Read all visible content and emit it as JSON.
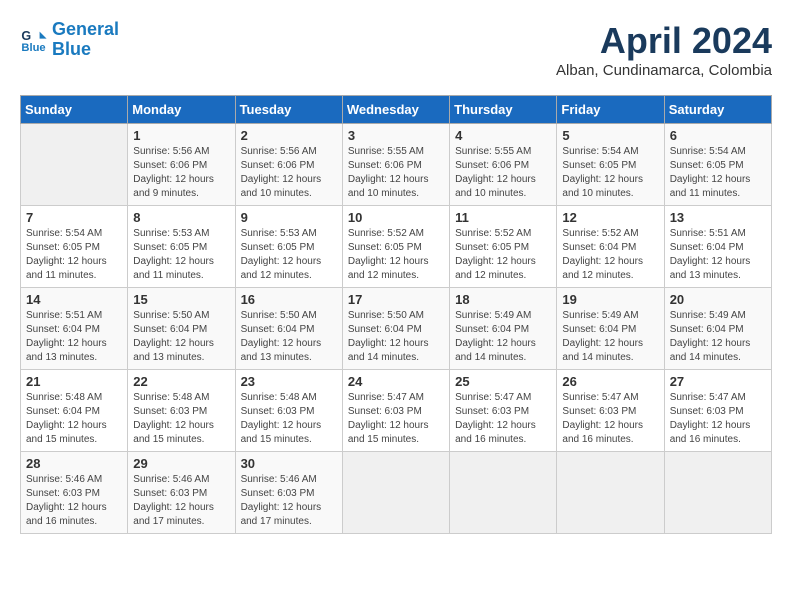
{
  "header": {
    "logo_line1": "General",
    "logo_line2": "Blue",
    "month_title": "April 2024",
    "location": "Alban, Cundinamarca, Colombia"
  },
  "days_of_week": [
    "Sunday",
    "Monday",
    "Tuesday",
    "Wednesday",
    "Thursday",
    "Friday",
    "Saturday"
  ],
  "weeks": [
    [
      {
        "day": "",
        "info": ""
      },
      {
        "day": "1",
        "info": "Sunrise: 5:56 AM\nSunset: 6:06 PM\nDaylight: 12 hours\nand 9 minutes."
      },
      {
        "day": "2",
        "info": "Sunrise: 5:56 AM\nSunset: 6:06 PM\nDaylight: 12 hours\nand 10 minutes."
      },
      {
        "day": "3",
        "info": "Sunrise: 5:55 AM\nSunset: 6:06 PM\nDaylight: 12 hours\nand 10 minutes."
      },
      {
        "day": "4",
        "info": "Sunrise: 5:55 AM\nSunset: 6:06 PM\nDaylight: 12 hours\nand 10 minutes."
      },
      {
        "day": "5",
        "info": "Sunrise: 5:54 AM\nSunset: 6:05 PM\nDaylight: 12 hours\nand 10 minutes."
      },
      {
        "day": "6",
        "info": "Sunrise: 5:54 AM\nSunset: 6:05 PM\nDaylight: 12 hours\nand 11 minutes."
      }
    ],
    [
      {
        "day": "7",
        "info": "Sunrise: 5:54 AM\nSunset: 6:05 PM\nDaylight: 12 hours\nand 11 minutes."
      },
      {
        "day": "8",
        "info": "Sunrise: 5:53 AM\nSunset: 6:05 PM\nDaylight: 12 hours\nand 11 minutes."
      },
      {
        "day": "9",
        "info": "Sunrise: 5:53 AM\nSunset: 6:05 PM\nDaylight: 12 hours\nand 12 minutes."
      },
      {
        "day": "10",
        "info": "Sunrise: 5:52 AM\nSunset: 6:05 PM\nDaylight: 12 hours\nand 12 minutes."
      },
      {
        "day": "11",
        "info": "Sunrise: 5:52 AM\nSunset: 6:05 PM\nDaylight: 12 hours\nand 12 minutes."
      },
      {
        "day": "12",
        "info": "Sunrise: 5:52 AM\nSunset: 6:04 PM\nDaylight: 12 hours\nand 12 minutes."
      },
      {
        "day": "13",
        "info": "Sunrise: 5:51 AM\nSunset: 6:04 PM\nDaylight: 12 hours\nand 13 minutes."
      }
    ],
    [
      {
        "day": "14",
        "info": "Sunrise: 5:51 AM\nSunset: 6:04 PM\nDaylight: 12 hours\nand 13 minutes."
      },
      {
        "day": "15",
        "info": "Sunrise: 5:50 AM\nSunset: 6:04 PM\nDaylight: 12 hours\nand 13 minutes."
      },
      {
        "day": "16",
        "info": "Sunrise: 5:50 AM\nSunset: 6:04 PM\nDaylight: 12 hours\nand 13 minutes."
      },
      {
        "day": "17",
        "info": "Sunrise: 5:50 AM\nSunset: 6:04 PM\nDaylight: 12 hours\nand 14 minutes."
      },
      {
        "day": "18",
        "info": "Sunrise: 5:49 AM\nSunset: 6:04 PM\nDaylight: 12 hours\nand 14 minutes."
      },
      {
        "day": "19",
        "info": "Sunrise: 5:49 AM\nSunset: 6:04 PM\nDaylight: 12 hours\nand 14 minutes."
      },
      {
        "day": "20",
        "info": "Sunrise: 5:49 AM\nSunset: 6:04 PM\nDaylight: 12 hours\nand 14 minutes."
      }
    ],
    [
      {
        "day": "21",
        "info": "Sunrise: 5:48 AM\nSunset: 6:04 PM\nDaylight: 12 hours\nand 15 minutes."
      },
      {
        "day": "22",
        "info": "Sunrise: 5:48 AM\nSunset: 6:03 PM\nDaylight: 12 hours\nand 15 minutes."
      },
      {
        "day": "23",
        "info": "Sunrise: 5:48 AM\nSunset: 6:03 PM\nDaylight: 12 hours\nand 15 minutes."
      },
      {
        "day": "24",
        "info": "Sunrise: 5:47 AM\nSunset: 6:03 PM\nDaylight: 12 hours\nand 15 minutes."
      },
      {
        "day": "25",
        "info": "Sunrise: 5:47 AM\nSunset: 6:03 PM\nDaylight: 12 hours\nand 16 minutes."
      },
      {
        "day": "26",
        "info": "Sunrise: 5:47 AM\nSunset: 6:03 PM\nDaylight: 12 hours\nand 16 minutes."
      },
      {
        "day": "27",
        "info": "Sunrise: 5:47 AM\nSunset: 6:03 PM\nDaylight: 12 hours\nand 16 minutes."
      }
    ],
    [
      {
        "day": "28",
        "info": "Sunrise: 5:46 AM\nSunset: 6:03 PM\nDaylight: 12 hours\nand 16 minutes."
      },
      {
        "day": "29",
        "info": "Sunrise: 5:46 AM\nSunset: 6:03 PM\nDaylight: 12 hours\nand 17 minutes."
      },
      {
        "day": "30",
        "info": "Sunrise: 5:46 AM\nSunset: 6:03 PM\nDaylight: 12 hours\nand 17 minutes."
      },
      {
        "day": "",
        "info": ""
      },
      {
        "day": "",
        "info": ""
      },
      {
        "day": "",
        "info": ""
      },
      {
        "day": "",
        "info": ""
      }
    ]
  ]
}
